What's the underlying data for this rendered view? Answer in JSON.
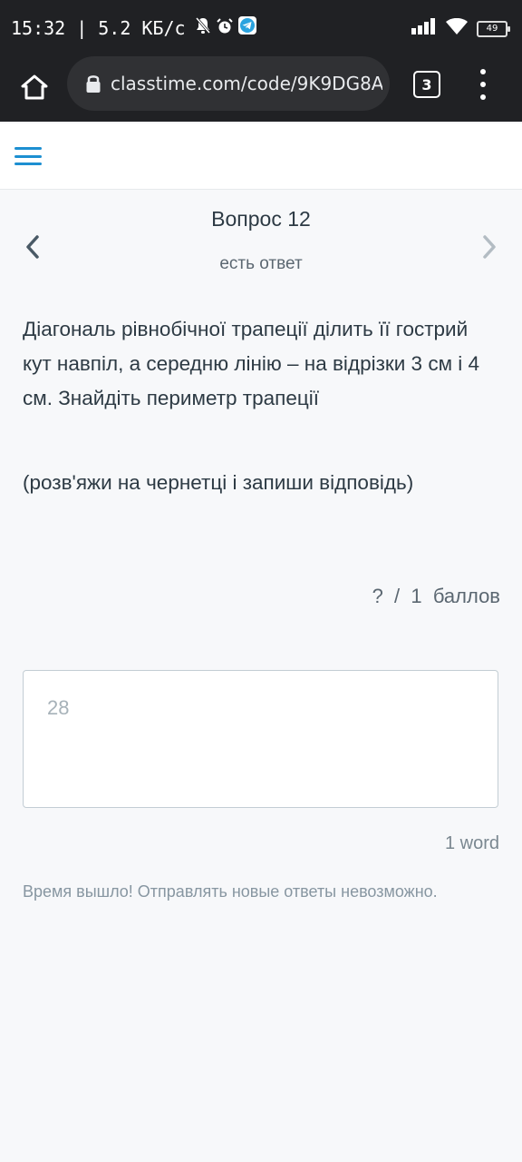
{
  "status": {
    "time": "15:32",
    "separator": "|",
    "speed": "5.2 КБ/с",
    "battery": "49",
    "icons": [
      "mute-bell-icon",
      "alarm-icon",
      "telegram-icon",
      "signal-icon",
      "wifi-icon",
      "battery-icon"
    ]
  },
  "browser": {
    "url": "classtime.com/code/9K9DG8A",
    "tab_count": "3",
    "icons": [
      "home-icon",
      "lock-icon",
      "more-vert-icon"
    ]
  },
  "header": {
    "menu_icon": "hamburger-menu-icon"
  },
  "question_nav": {
    "title": "Вопрос 12",
    "status": "есть ответ",
    "prev_icon": "chevron-left-icon",
    "next_icon": "chevron-right-icon"
  },
  "question": {
    "text": "Діагональ рівнобічної трапеції ділить її гострий кут навпіл, а середню лінію – на відрізки 3 см і 4 см. Знайдіть периметр трапеції",
    "instruction": "(розв'яжи на чернетці  і запиши відповідь)"
  },
  "score": {
    "text": "?  /  1  баллов"
  },
  "answer": {
    "value": "28",
    "word_count": "1 word"
  },
  "message": {
    "expired": "Время вышло! Отправлять новые ответы невозможно."
  },
  "colors": {
    "accent": "#1d8fd1",
    "text": "#2d3a44",
    "muted": "#8796a1",
    "browser_bg": "#202124"
  }
}
